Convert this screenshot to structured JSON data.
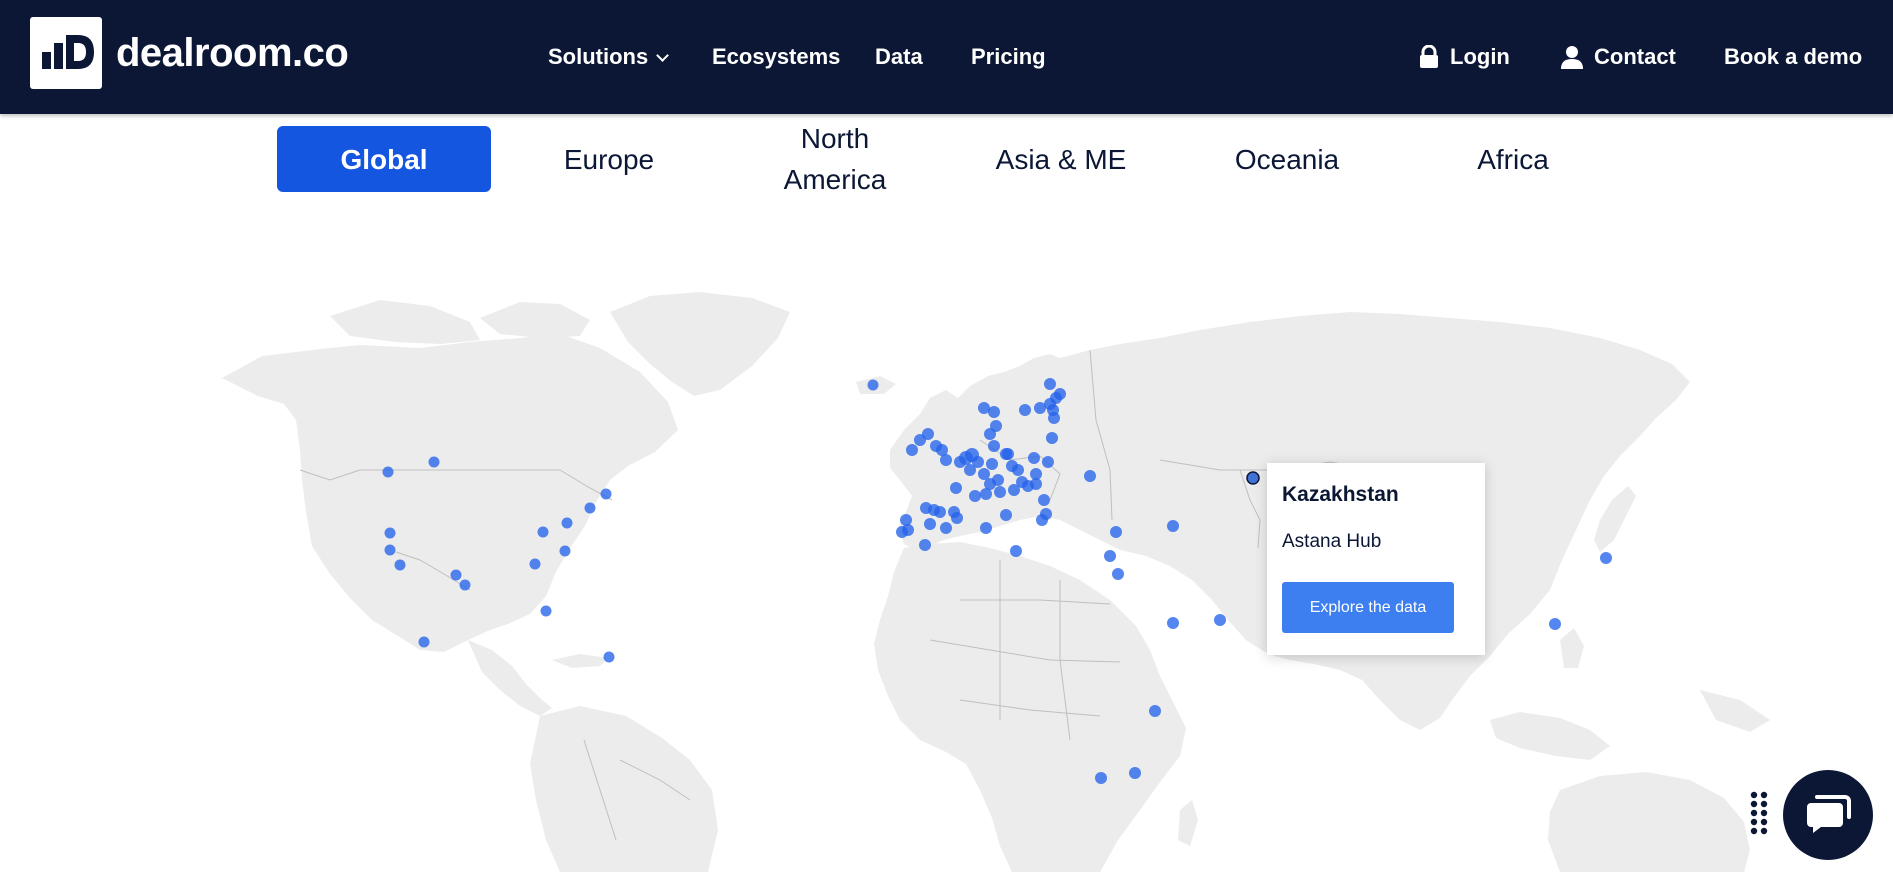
{
  "brand": {
    "name": "dealroom.co",
    "logo_icon": "dealroom-logo-icon"
  },
  "nav": {
    "solutions": "Solutions",
    "ecosystems": "Ecosystems",
    "data": "Data",
    "pricing": "Pricing",
    "login": "Login",
    "contact": "Contact",
    "book_demo": "Book a demo"
  },
  "region_tabs": {
    "global": "Global",
    "europe": "Europe",
    "north_america_line1": "North",
    "north_america_line2": "America",
    "asia_me": "Asia & ME",
    "oceania": "Oceania",
    "africa": "Africa",
    "selected": "Global"
  },
  "popup": {
    "country": "Kazakhstan",
    "hub": "Astana Hub",
    "button": "Explore the data"
  },
  "colors": {
    "navy": "#0b1735",
    "accent": "#1556e0",
    "button": "#3d7ff0",
    "dot": "#2563eb",
    "land": "#ececec"
  },
  "icons": [
    "lock-icon",
    "user-icon",
    "chevron-down-icon",
    "chat-icon",
    "keypad-icon"
  ]
}
